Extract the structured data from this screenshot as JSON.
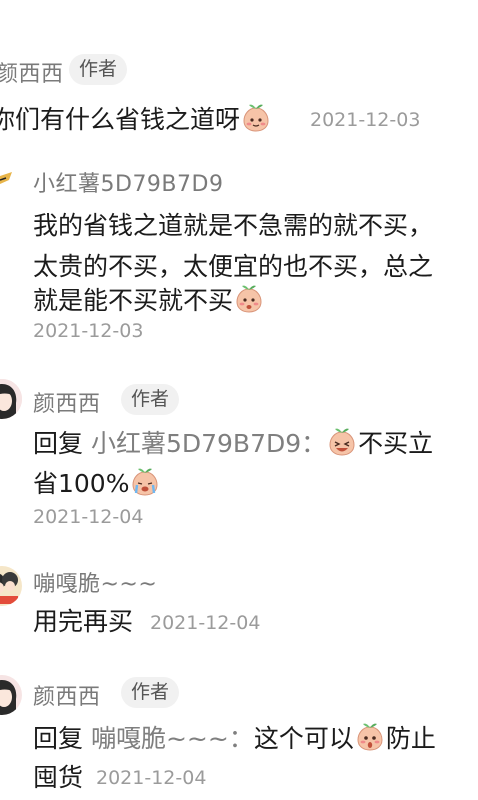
{
  "comments": [
    {
      "author": "颜西西",
      "badge": "作者",
      "text": "你们有什么省钱之道呀",
      "date": "2021-12-03"
    },
    {
      "author": "小红薯5D79B7D9",
      "line1": "我的省钱之道就是不急需的就不买，",
      "line2": "太贵的不买，太便宜的也不买，总之",
      "line3": "就是能不买就不买",
      "date": "2021-12-03"
    },
    {
      "author": "颜西西",
      "badge": "作者",
      "reply_prefix": "回复",
      "mention": "小红薯5D79B7D9：",
      "text_a": "不买立",
      "text_b": "省100%",
      "date": "2021-12-04"
    },
    {
      "author": "嘣嘎脆~~~",
      "text": "用完再买",
      "date": "2021-12-04"
    },
    {
      "author": "颜西西",
      "badge": "作者",
      "reply_prefix": "回复",
      "mention": "嘣嘎脆~~~：",
      "text_a": "这个可以",
      "text_b": "防止",
      "text_c": "囤货",
      "date": "2021-12-04"
    }
  ],
  "colors": {
    "emoji_peach": "#f6c4a8",
    "emoji_leaf": "#6cc070",
    "avatar_bg": "#f3d9d9"
  },
  "icons": [
    "peach-shy-emoji",
    "peach-laugh-emoji",
    "peach-cry-emoji",
    "peach-surprised-emoji"
  ]
}
